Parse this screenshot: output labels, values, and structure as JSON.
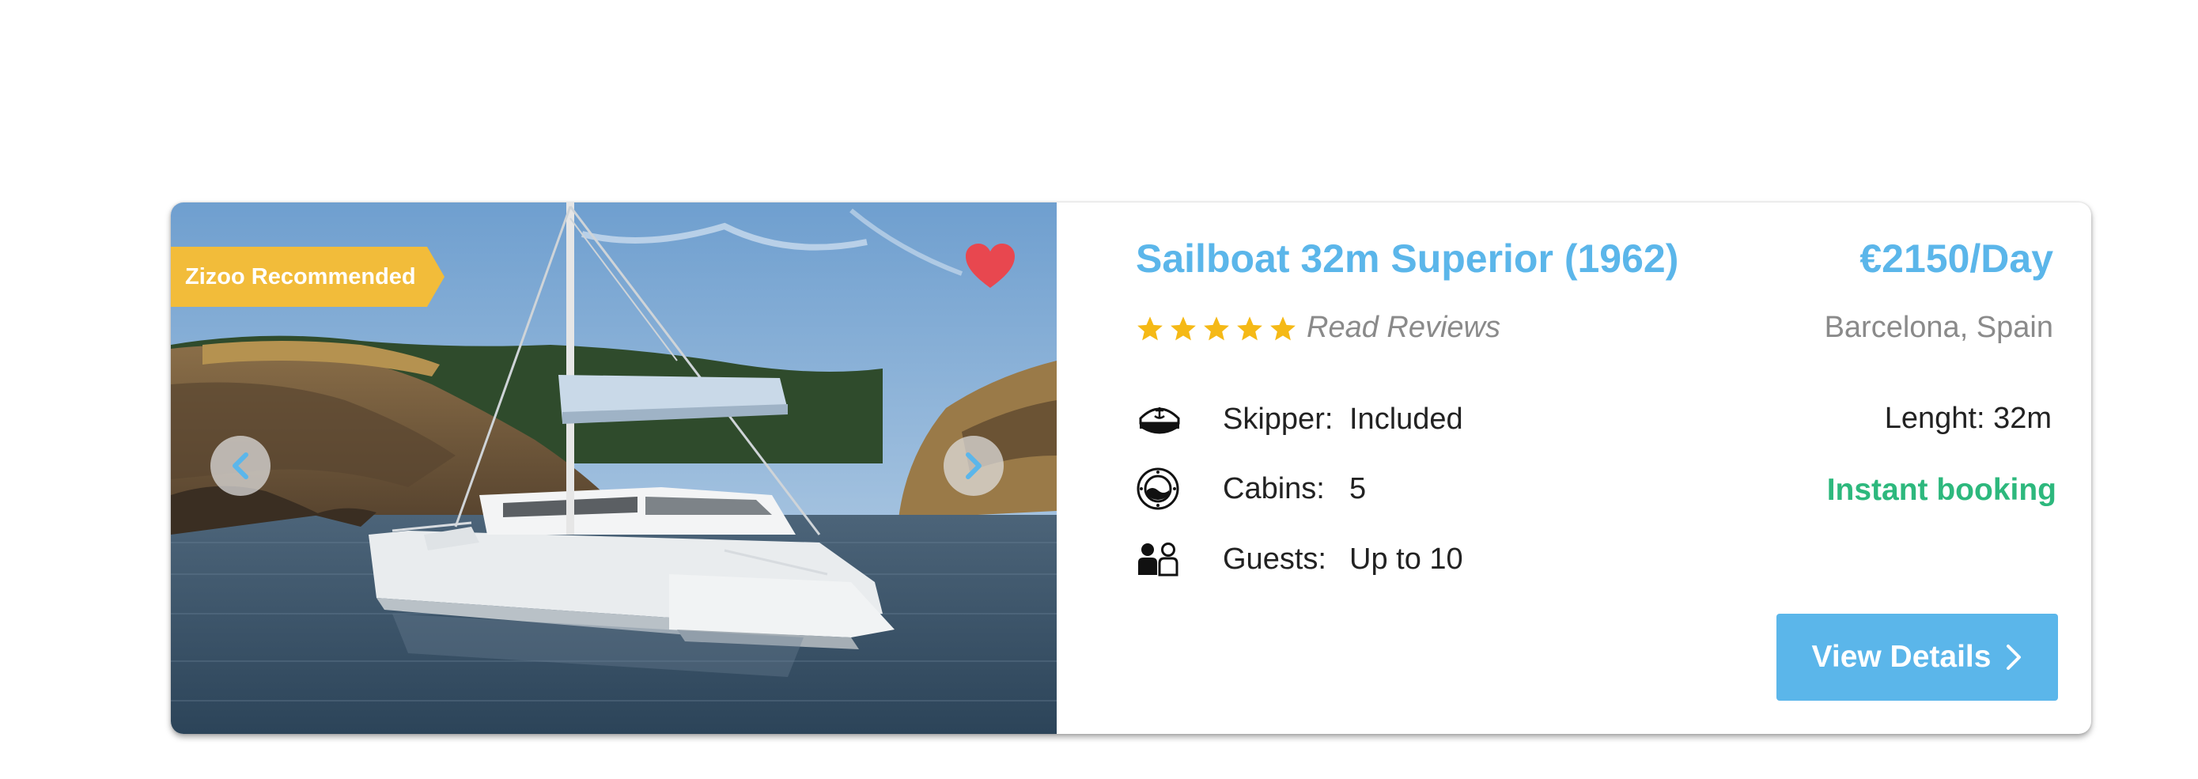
{
  "listing": {
    "badge": "Zizoo Recommended",
    "title": "Sailboat 32m Superior (1962)",
    "price": "€2150/Day",
    "rating": 5,
    "reviews_link": "Read Reviews",
    "location": "Barcelona, Spain",
    "specs": [
      {
        "label": "Skipper:",
        "value": "Included",
        "icon": "captain-hat-icon"
      },
      {
        "label": "Cabins:",
        "value": "5",
        "icon": "porthole-icon"
      },
      {
        "label": "Guests:",
        "value": "Up to 10",
        "icon": "guests-icon"
      }
    ],
    "length": "Lenght: 32m",
    "instant_booking": "Instant booking",
    "view_button": "View Details",
    "favorited": true
  },
  "colors": {
    "accent": "#5bb6ea",
    "badge": "#f2bc3a",
    "star": "#f5b916",
    "heart": "#e8474f",
    "instant": "#2db87d",
    "muted": "#8a8a8a"
  }
}
